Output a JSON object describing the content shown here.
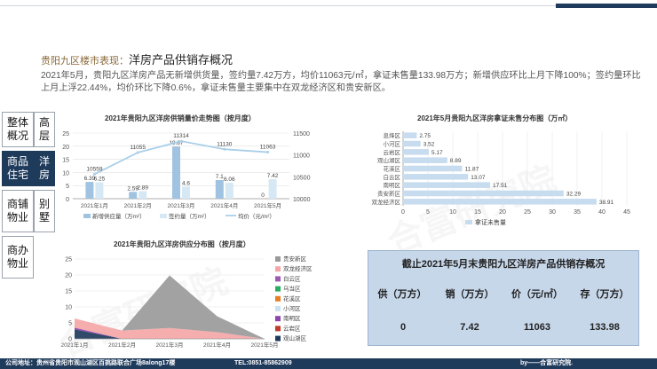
{
  "header": {
    "section": "贵阳九区楼市表现：",
    "title": "洋房产品供销存概况"
  },
  "summary_text": "2021年5月，贵阳九区洋房产品无新增供货量，签约量7.42万方，均价11063元/㎡，拿证未售量133.98万方；新增供应环比上月下降100%；签约量环比上月上浮22.44%，均价环比下降0.6%，拿证未售量主要集中在双龙经济区和贵安新区。",
  "nav": {
    "overview": "整体\n概况",
    "residential": "商品\n住宅",
    "highrise": "高层",
    "yanfang": "洋房",
    "villa": "别\n墅",
    "shop": "商铺\n物业",
    "office": "商办\n物业"
  },
  "watermark": "合富研究院",
  "chart_data": [
    {
      "type": "bar",
      "title": "2021年贵阳九区洋房供销量价走势图（按月度）",
      "categories": [
        "2021年1月",
        "2021年2月",
        "2021年3月",
        "2021年4月",
        "2021年5月"
      ],
      "series": [
        {
          "name": "新增供应量（万m²）",
          "kind": "bar",
          "axis": "left",
          "color": "#9fc3e0",
          "values": [
            6.39,
            2.59,
            19.87,
            7.1,
            0
          ]
        },
        {
          "name": "签约量（万m²）",
          "kind": "bar",
          "axis": "left",
          "color": "#d7e8f5",
          "values": [
            6.25,
            2.89,
            4.6,
            6.06,
            7.42
          ]
        },
        {
          "name": "均价（元/m²）",
          "kind": "line",
          "axis": "right",
          "color": "#a9cfea",
          "values": [
            10559,
            11055,
            11314,
            11130,
            11063
          ]
        }
      ],
      "data_labels": {
        "supply": [
          "6.39",
          "2.59",
          "19.87",
          "7.1",
          "0"
        ],
        "sign": [
          "6.25",
          "2.89",
          "4.6",
          "6.06",
          "7.42"
        ],
        "price": [
          "10559",
          "11055",
          "11314",
          "11130",
          "11063"
        ]
      },
      "y_left": {
        "min": 0,
        "max": 25,
        "ticks": [
          "0",
          "5",
          "10",
          "15",
          "20",
          "25"
        ]
      },
      "y_right": {
        "min": 10000,
        "max": 11500,
        "ticks": [
          "10000",
          "10500",
          "11000",
          "11500"
        ]
      },
      "legend": "bottom"
    },
    {
      "type": "bar",
      "orientation": "horizontal",
      "title": "2021年5月贵阳九区洋房拿证未售分布图（万㎡）",
      "categories": [
        "息烽区",
        "小河区",
        "云岩区",
        "观山湖区",
        "花溪区",
        "白云区",
        "南明区",
        "贵安新区",
        "双龙经济区"
      ],
      "values": [
        2.75,
        3.52,
        5.17,
        8.89,
        11.87,
        13.07,
        17.51,
        32.29,
        38.91
      ],
      "value_labels": [
        "2.75",
        "3.52",
        "5.17",
        "8.89",
        "11.87",
        "13.07",
        "17.51",
        "32.29",
        "38.91"
      ],
      "xlim": [
        0,
        45
      ],
      "x_ticks": [
        "0",
        "5",
        "10",
        "15",
        "20",
        "25",
        "30",
        "35",
        "40",
        "45"
      ],
      "legend": [
        "拿证未售量"
      ],
      "color": "#c7dcef"
    },
    {
      "type": "area",
      "title": "2021年贵阳九区洋房供应分布图（按月度）",
      "categories": [
        "2021年1月",
        "2021年2月",
        "2021年3月",
        "2021年4月",
        "2021年5月"
      ],
      "ylim": [
        0,
        25
      ],
      "y_ticks": [
        "0",
        "5",
        "10",
        "15",
        "20",
        "25"
      ],
      "legend": "right",
      "series": [
        {
          "name": "观山湖区",
          "color": "#1f3b5c",
          "values": [
            3,
            0,
            0,
            0,
            0
          ]
        },
        {
          "name": "云岩区",
          "color": "#c0392b",
          "values": [
            0,
            0,
            0,
            0,
            0
          ]
        },
        {
          "name": "南明区",
          "color": "#8e44ad",
          "values": [
            0.5,
            0,
            0,
            0,
            0
          ]
        },
        {
          "name": "小河区",
          "color": "#c9e3f5",
          "values": [
            0,
            0,
            0,
            0,
            0
          ]
        },
        {
          "name": "花溪区",
          "color": "#e67e22",
          "values": [
            0,
            0,
            0,
            0,
            0
          ]
        },
        {
          "name": "乌当区",
          "color": "#27ae60",
          "values": [
            0,
            0,
            0,
            0,
            0
          ]
        },
        {
          "name": "白云区",
          "color": "#9b59b6",
          "values": [
            0,
            0,
            0,
            0,
            0
          ]
        },
        {
          "name": "双龙经济区",
          "color": "#f4a6a6",
          "values": [
            2.9,
            2.59,
            3.4,
            2.1,
            0
          ]
        },
        {
          "name": "贵安新区",
          "color": "#9a9a9a",
          "values": [
            0,
            0,
            16.47,
            5.0,
            0
          ]
        }
      ]
    }
  ],
  "summary_table": {
    "title": "截止2021年5月末贵阳九区洋房产品供销存概况",
    "headers": [
      "供（万方）",
      "销（万方）",
      "价（元/㎡）",
      "存（万方）"
    ],
    "values": [
      "0",
      "7.42",
      "11063",
      "133.98"
    ]
  },
  "footer": {
    "address": "公司地址：贵州省贵阳市观山湖区百挑路联合广场8along17楼",
    "tel": "TEL:0851-85862909",
    "by": "by——合富研究院."
  }
}
